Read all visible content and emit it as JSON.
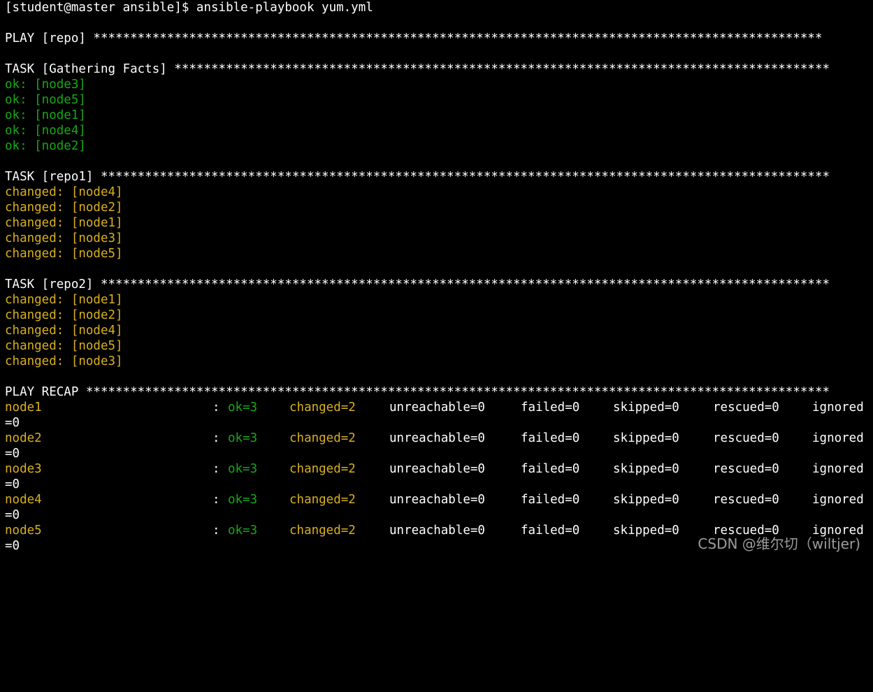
{
  "colors": {
    "background": "#000000",
    "text": "#ffffff",
    "ok": "#15a815",
    "changed": "#d8b01e"
  },
  "prompt": "[student@master ansible]$ ansible-playbook yum.yml",
  "play_header": "PLAY [repo] ***************************************************************************************************",
  "tasks": [
    {
      "header": "TASK [Gathering Facts] *****************************************************************************************",
      "results": [
        "ok: [node3]",
        "ok: [node5]",
        "ok: [node1]",
        "ok: [node4]",
        "ok: [node2]"
      ],
      "status": "ok"
    },
    {
      "header": "TASK [repo1] ***************************************************************************************************",
      "results": [
        "changed: [node4]",
        "changed: [node2]",
        "changed: [node1]",
        "changed: [node3]",
        "changed: [node5]"
      ],
      "status": "changed"
    },
    {
      "header": "TASK [repo2] ***************************************************************************************************",
      "results": [
        "changed: [node1]",
        "changed: [node2]",
        "changed: [node4]",
        "changed: [node5]",
        "changed: [node3]"
      ],
      "status": "changed"
    }
  ],
  "recap_header": "PLAY RECAP *****************************************************************************************************",
  "recap": [
    {
      "host": "node1",
      "colon": ":",
      "ok": "ok=3",
      "changed": "changed=2",
      "unreachable": "unreachable=0",
      "failed": "failed=0",
      "skipped": "skipped=0",
      "rescued": "rescued=0",
      "ignored": "ignored",
      "wrap": "=0"
    },
    {
      "host": "node2",
      "colon": ":",
      "ok": "ok=3",
      "changed": "changed=2",
      "unreachable": "unreachable=0",
      "failed": "failed=0",
      "skipped": "skipped=0",
      "rescued": "rescued=0",
      "ignored": "ignored",
      "wrap": "=0"
    },
    {
      "host": "node3",
      "colon": ":",
      "ok": "ok=3",
      "changed": "changed=2",
      "unreachable": "unreachable=0",
      "failed": "failed=0",
      "skipped": "skipped=0",
      "rescued": "rescued=0",
      "ignored": "ignored",
      "wrap": "=0"
    },
    {
      "host": "node4",
      "colon": ":",
      "ok": "ok=3",
      "changed": "changed=2",
      "unreachable": "unreachable=0",
      "failed": "failed=0",
      "skipped": "skipped=0",
      "rescued": "rescued=0",
      "ignored": "ignored",
      "wrap": "=0"
    },
    {
      "host": "node5",
      "colon": ":",
      "ok": "ok=3",
      "changed": "changed=2",
      "unreachable": "unreachable=0",
      "failed": "failed=0",
      "skipped": "skipped=0",
      "rescued": "rescued=0",
      "ignored": "ignored",
      "wrap": "=0"
    }
  ],
  "watermark": "CSDN @维尔切（wiltjer)"
}
